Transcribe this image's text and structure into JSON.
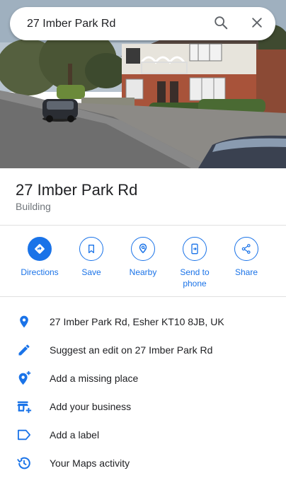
{
  "search": {
    "value": "27 Imber Park Rd",
    "search_icon": "search-icon",
    "close_icon": "close-icon"
  },
  "place": {
    "title": "27 Imber Park Rd",
    "category": "Building"
  },
  "actions": [
    {
      "label": "Directions",
      "icon": "directions-icon"
    },
    {
      "label": "Save",
      "icon": "bookmark-icon"
    },
    {
      "label": "Nearby",
      "icon": "nearby-icon"
    },
    {
      "label": "Send to phone",
      "icon": "send-to-phone-icon"
    },
    {
      "label": "Share",
      "icon": "share-icon"
    }
  ],
  "details": [
    {
      "text": "27 Imber Park Rd, Esher KT10 8JB, UK",
      "icon": "location-pin-icon"
    },
    {
      "text": "Suggest an edit on 27 Imber Park Rd",
      "icon": "pencil-icon"
    },
    {
      "text": "Add a missing place",
      "icon": "add-location-icon"
    },
    {
      "text": "Add your business",
      "icon": "add-business-icon"
    },
    {
      "text": "Add a label",
      "icon": "label-icon"
    },
    {
      "text": "Your Maps activity",
      "icon": "history-icon"
    }
  ],
  "colors": {
    "accent": "#1a73e8",
    "text": "#202124",
    "secondary_text": "#70757a",
    "divider": "#e0e0e0"
  }
}
